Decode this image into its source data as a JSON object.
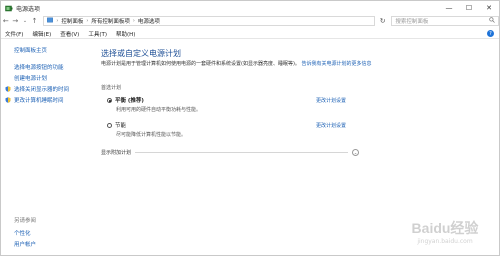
{
  "window": {
    "title": "电源选项",
    "controls": {
      "minimize": "—",
      "maximize": "☐",
      "close": "✕"
    }
  },
  "nav": {
    "back": "←",
    "forward": "→",
    "history": "⌄",
    "up": "↑",
    "breadcrumb": [
      "控制面板",
      "所有控制面板项",
      "电源选项"
    ],
    "refresh": "↻",
    "search_placeholder": "搜索控制面板"
  },
  "menu": {
    "items": [
      "文件(F)",
      "编辑(E)",
      "查看(V)",
      "工具(T)",
      "帮助(H)"
    ],
    "help_glyph": "?"
  },
  "sidebar": {
    "home": "控制面板主页",
    "links": [
      "选择电源按钮的功能",
      "创建电源计划"
    ],
    "icon_links": [
      "选择关闭显示器的时间",
      "更改计算机睡眠时间"
    ],
    "see_also_label": "另请参阅",
    "see_also": [
      "个性化",
      "用户帐户"
    ]
  },
  "main": {
    "heading": "选择或自定义电源计划",
    "description": "电源计划是用于管理计算机如何使用电源的一套硬件和系统设置(如显示器亮度、睡眠等)。",
    "description_link": "告诉我有关电源计划的更多信息",
    "section_label": "首选计划",
    "plans": [
      {
        "name": "平衡 (推荐)",
        "description": "利用可用的硬件自动平衡功耗与性能。",
        "link": "更改计划设置",
        "selected": true
      },
      {
        "name": "节能",
        "description": "尽可能降低计算机性能以节能。",
        "link": "更改计划设置",
        "selected": false
      }
    ],
    "extra_plans": "显示附加计划",
    "expand_glyph": "⌄"
  },
  "watermark": {
    "brand": "Baidu经验",
    "url": "jingyan.baidu.com"
  },
  "colors": {
    "link": "#1a5fb4",
    "heading": "#1e4f96",
    "accent": "#1e73d8"
  }
}
